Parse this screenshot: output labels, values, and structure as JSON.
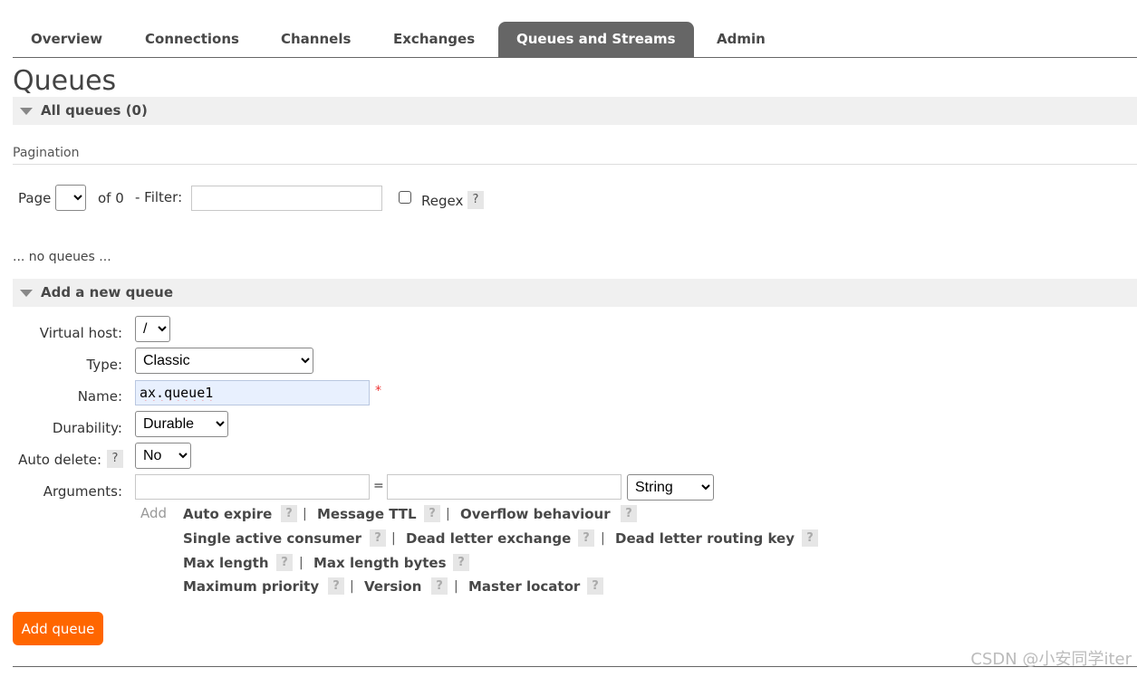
{
  "tabs": [
    "Overview",
    "Connections",
    "Channels",
    "Exchanges",
    "Queues and Streams",
    "Admin"
  ],
  "active_tab": "Queues and Streams",
  "page_title": "Queues",
  "all_queues": {
    "label": "All queues (0)"
  },
  "pagination": {
    "label": "Pagination",
    "page_label": "Page",
    "of_label": "of 0",
    "filter_label": "- Filter:",
    "filter_value": "",
    "regex_label": "Regex",
    "regex_checked": false,
    "help": "?"
  },
  "no_queues": "... no queues ...",
  "add_queue_section": {
    "label": "Add a new queue"
  },
  "form": {
    "vhost_label": "Virtual host:",
    "vhost_value": "/",
    "type_label": "Type:",
    "type_value": "Classic",
    "name_label": "Name:",
    "name_value": "ax.queue1",
    "required_marker": "*",
    "durability_label": "Durability:",
    "durability_value": "Durable",
    "auto_delete_label": "Auto delete:",
    "auto_delete_value": "No",
    "arguments_label": "Arguments:",
    "arg_equals": "=",
    "arg_type_value": "String",
    "add_label": "Add"
  },
  "argument_links": {
    "row1": [
      "Auto expire",
      "Message TTL",
      "Overflow behaviour"
    ],
    "row2": [
      "Single active consumer",
      "Dead letter exchange",
      "Dead letter routing key"
    ],
    "row3": [
      "Max length",
      "Max length bytes"
    ],
    "row4": [
      "Maximum priority",
      "Version",
      "Master locator"
    ]
  },
  "separator": "|",
  "add_queue_button": "Add queue",
  "watermark": "CSDN @小安同学iter",
  "colors": {
    "accent": "#ff6600",
    "active_tab": "#666666",
    "section_bg": "#f0f0f0"
  }
}
